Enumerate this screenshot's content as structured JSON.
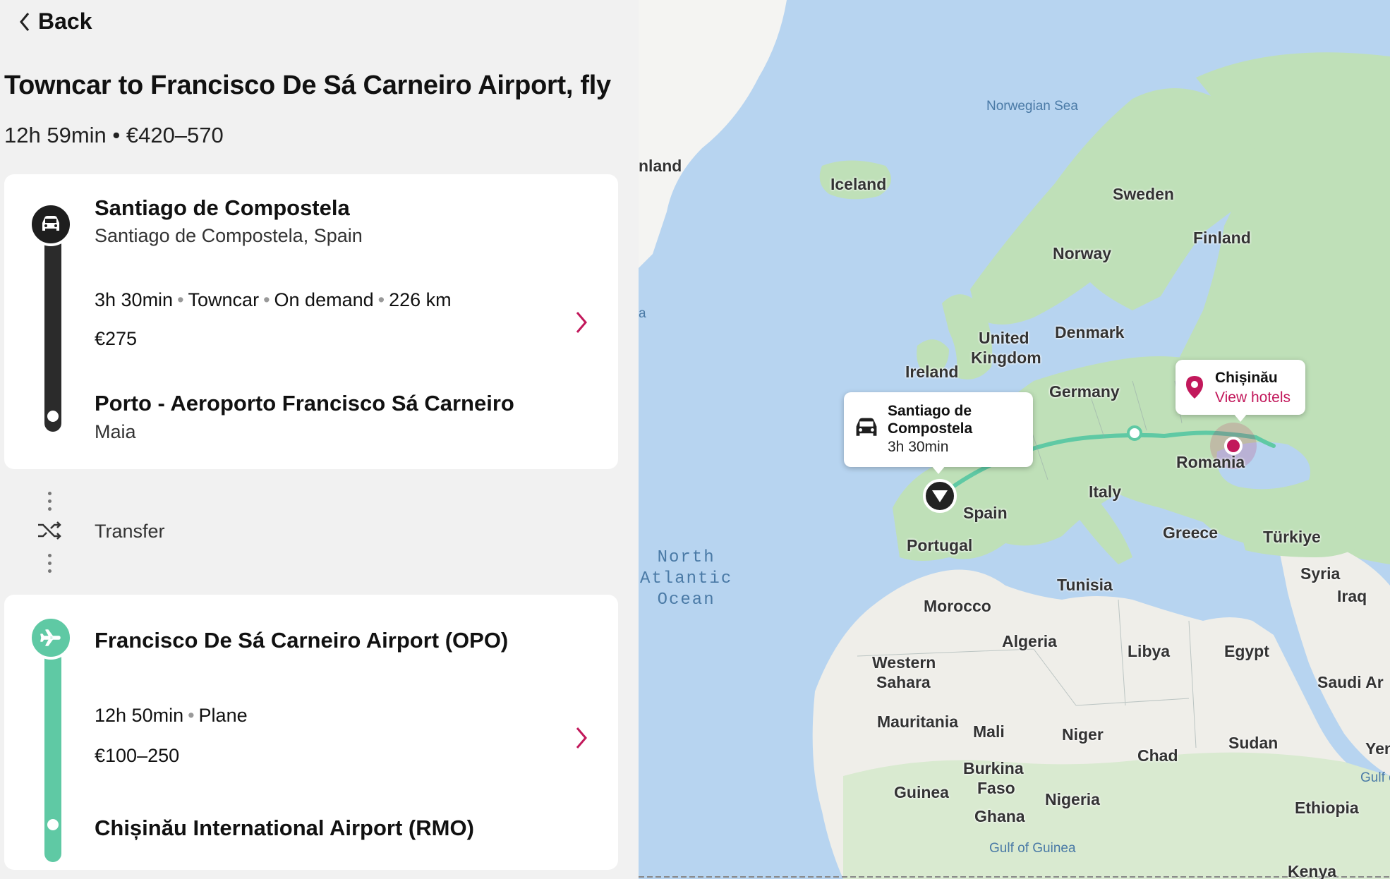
{
  "header": {
    "back_label": "Back",
    "title": "Towncar to Francisco De Sá Carneiro Airport, fly",
    "summary": "12h 59min • €420–570"
  },
  "segments": [
    {
      "icon": "car-icon",
      "from_name": "Santiago de Compostela",
      "from_sub": "Santiago de Compostela, Spain",
      "duration": "3h 30min",
      "mode": "Towncar",
      "frequency": "On demand",
      "distance": "226 km",
      "price": "€275",
      "to_name": "Porto - Aeroporto Francisco Sá Carneiro",
      "to_sub": "Maia",
      "color": "#2b2b2b"
    },
    {
      "icon": "plane-icon",
      "from_name": "Francisco De Sá Carneiro Airport (OPO)",
      "duration": "12h 50min",
      "mode": "Plane",
      "price": "€100–250",
      "to_name": "Chișinău International Airport (RMO)",
      "color": "#5fc9a4"
    }
  ],
  "transfer": {
    "label": "Transfer",
    "icon": "shuffle-icon"
  },
  "map": {
    "origin_popup": {
      "title_line1": "Santiago de",
      "title_line2": "Compostela",
      "duration": "3h 30min",
      "icon": "car-icon"
    },
    "destination_popup": {
      "title": "Chișinău",
      "link": "View hotels",
      "icon": "pin-icon"
    },
    "labels": {
      "greenland": "nland",
      "iceland": "Iceland",
      "norwegian_sea": "Norwegian Sea",
      "sweden": "Sweden",
      "finland": "Finland",
      "norway": "Norway",
      "denmark": "Denmark",
      "united": "United",
      "kingdom": "Kingdom",
      "ireland": "Ireland",
      "germany": "Germany",
      "romania": "Romania",
      "italy": "Italy",
      "spain": "Spain",
      "portugal": "Portugal",
      "greece": "Greece",
      "turkiye": "Türkiye",
      "syria": "Syria",
      "iraq": "Iraq",
      "north": "North",
      "atlantic": "Atlantic",
      "ocean": "Ocean",
      "tunisia": "Tunisia",
      "morocco": "Morocco",
      "algeria": "Algeria",
      "libya": "Libya",
      "egypt": "Egypt",
      "western": "Western",
      "sahara": "Sahara",
      "saudi": "Saudi Ar",
      "mauritania": "Mauritania",
      "mali": "Mali",
      "niger": "Niger",
      "chad": "Chad",
      "sudan": "Sudan",
      "yemen": "Yen",
      "gulf_aden": "Gulf o",
      "burkina": "Burkina",
      "faso": "Faso",
      "guinea": "Guinea",
      "nigeria": "Nigeria",
      "ghana": "Ghana",
      "ethiopia": "Ethiopia",
      "gulf_guinea": "Gulf of Guinea",
      "kenya": "Kenya",
      "edge_a": "a"
    },
    "colors": {
      "water": "#b7d4f0",
      "land_green": "#bfe0b8",
      "land_desert": "#efeee9",
      "route": "#5fc9a4",
      "accent": "#c2185b"
    }
  }
}
